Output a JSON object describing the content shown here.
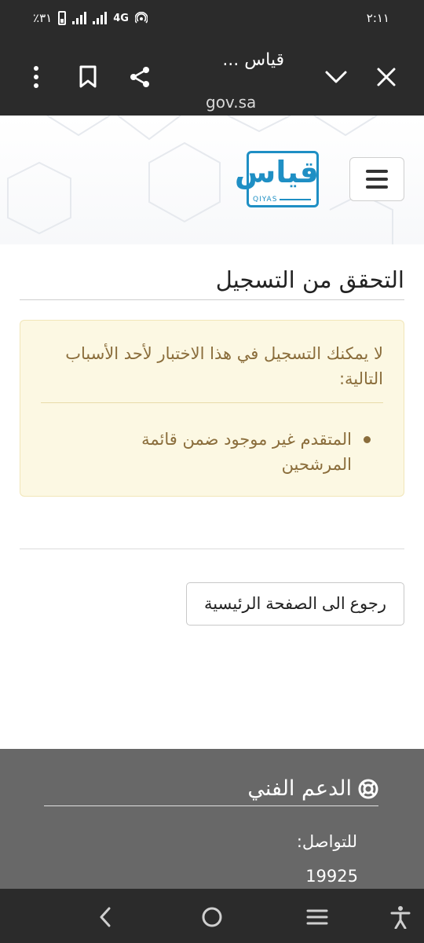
{
  "status_bar": {
    "time": "٢:١١",
    "battery": "٪٣١",
    "network": "4G"
  },
  "browser": {
    "page_title": "قياس ...",
    "url": "gov.sa"
  },
  "header": {
    "logo_text_ar": "قياس",
    "logo_text_en": "QIYAS",
    "brand_color": "#1f8fc4"
  },
  "main": {
    "heading": "التحقق من التسجيل",
    "alert": {
      "message": "لا يمكنك التسجيل في هذا الاختبار لأحد الأسباب التالية:",
      "reasons": [
        "المتقدم غير موجود ضمن قائمة المرشحين"
      ],
      "background_color": "#fcf8e3",
      "text_color": "#8a6d3b"
    },
    "home_button_label": "رجوع الى الصفحة الرئيسية"
  },
  "footer": {
    "support_title": "الدعم الفني",
    "contact_label": "للتواصل:",
    "contact_number": "19925",
    "background_color": "#686868"
  },
  "icons": {
    "close": "close-icon",
    "chevron": "chevron-down-icon",
    "share": "share-icon",
    "bookmark": "bookmark-icon",
    "menu": "more-vert-icon",
    "hamburger": "hamburger-icon",
    "support": "lifebuoy-icon"
  }
}
